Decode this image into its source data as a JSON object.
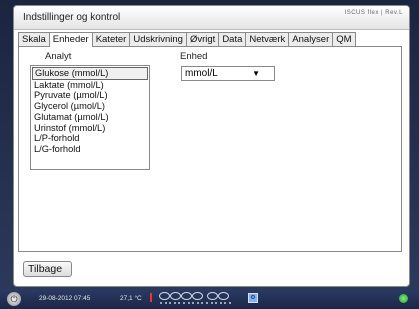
{
  "window": {
    "title": "Indstillinger og kontrol",
    "brand": "ISCUS flex | Rev.L"
  },
  "tabs": [
    {
      "label": "Skala",
      "active": false
    },
    {
      "label": "Enheder",
      "active": true
    },
    {
      "label": "Kateter",
      "active": false
    },
    {
      "label": "Udskrivning",
      "active": false
    },
    {
      "label": "Øvrigt",
      "active": false
    },
    {
      "label": "Data",
      "active": false
    },
    {
      "label": "Netværk",
      "active": false
    },
    {
      "label": "Analyser",
      "active": false
    },
    {
      "label": "QM",
      "active": false
    }
  ],
  "panel": {
    "analyte_header": "Analyt",
    "unit_header": "Enhed",
    "analytes": [
      "Glukose (mmol/L)",
      "Laktate (mmol/L)",
      "Pyruvate (µmol/L)",
      "Glycerol (µmol/L)",
      "Glutamat (µmol/L)",
      "Urinstof (mmol/L)",
      "L/P-forhold",
      "L/G-forhold"
    ],
    "selected_index": 0,
    "unit_value": "mmol/L",
    "unit_arrow": "▼"
  },
  "footer": {
    "back_label": "Tilbage"
  },
  "statusbar": {
    "datetime": "29-08-2012 07:45",
    "temperature": "27,1 °C",
    "power_glyph": "⏻",
    "status_glyph": "⚙"
  }
}
